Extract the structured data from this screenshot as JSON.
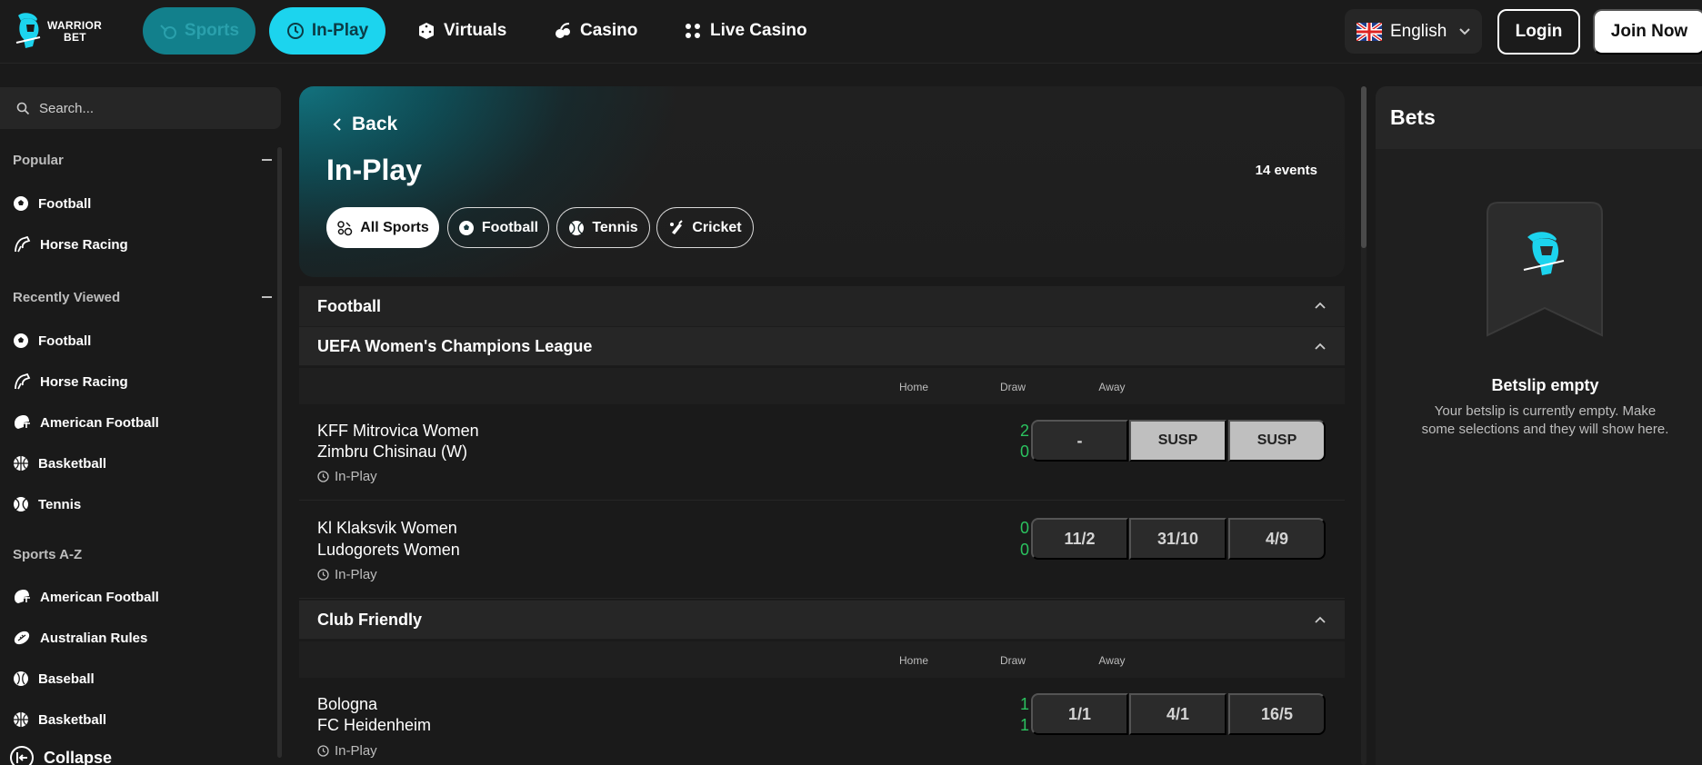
{
  "brand": {
    "line1": "WARRIOR",
    "line2": "BET",
    "accent": "#1cd4ee"
  },
  "nav": {
    "sports": "Sports",
    "inplay": "In-Play",
    "virtuals": "Virtuals",
    "casino": "Casino",
    "live_casino": "Live Casino"
  },
  "header": {
    "language": "English",
    "login": "Login",
    "join": "Join Now"
  },
  "sidebar": {
    "search_placeholder": "Search...",
    "popular": {
      "title": "Popular",
      "items": [
        "Football",
        "Horse Racing"
      ]
    },
    "recent": {
      "title": "Recently Viewed",
      "items": [
        "Football",
        "Horse Racing",
        "American Football",
        "Basketball",
        "Tennis"
      ]
    },
    "az": {
      "title": "Sports A-Z",
      "items": [
        "American Football",
        "Australian Rules",
        "Baseball",
        "Basketball"
      ]
    },
    "collapse": "Collapse"
  },
  "hero": {
    "back": "Back",
    "title": "In-Play",
    "events": "14 events",
    "chips": [
      "All Sports",
      "Football",
      "Tennis",
      "Cricket"
    ]
  },
  "sections": {
    "sport": "Football",
    "comp1": {
      "name": "UEFA Women's Champions League",
      "cols": [
        "Home",
        "Draw",
        "Away"
      ],
      "matches": [
        {
          "home": "KFF Mitrovica Women",
          "away": "Zimbru Chisinau (W)",
          "status": "In-Play",
          "score_home": "2",
          "score_away": "0",
          "odds": [
            "-",
            "SUSP",
            "SUSP"
          ]
        },
        {
          "home": "Kl Klaksvik Women",
          "away": "Ludogorets Women",
          "status": "In-Play",
          "score_home": "0",
          "score_away": "0",
          "odds": [
            "11/2",
            "31/10",
            "4/9"
          ]
        }
      ]
    },
    "comp2": {
      "name": "Club Friendly",
      "cols": [
        "Home",
        "Draw",
        "Away"
      ],
      "matches": [
        {
          "home": "Bologna",
          "away": "FC Heidenheim",
          "status": "In-Play",
          "score_home": "1",
          "score_away": "1",
          "odds": [
            "1/1",
            "4/1",
            "16/5"
          ]
        }
      ]
    }
  },
  "betslip": {
    "title": "Bets",
    "empty_title": "Betslip empty",
    "empty_text": "Your betslip is currently empty. Make some selections and they will show here."
  }
}
